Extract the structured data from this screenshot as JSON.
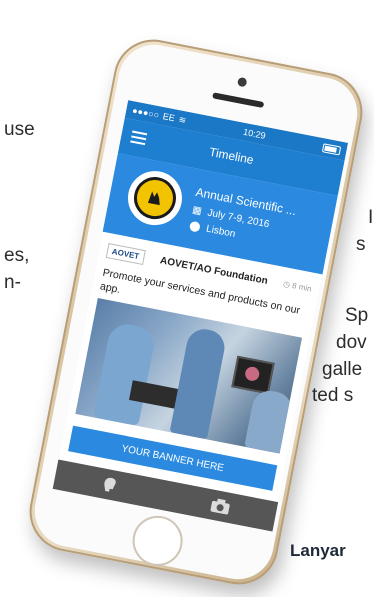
{
  "background_text": {
    "left_1": "use",
    "left_2": "es,",
    "left_3": "n-",
    "right_1": "I",
    "right_2": "s",
    "right_3": "Sp",
    "right_4": "dov",
    "right_5": "galle",
    "right_6": "ted s",
    "bottom": "Lanyar"
  },
  "status_bar": {
    "carrier": "EE",
    "time": "10:29"
  },
  "nav": {
    "title": "Timeline",
    "menu_icon": "hamburger-icon"
  },
  "event": {
    "title": "Annual Scientific ...",
    "date": "July 7-9, 2016",
    "location": "Lisbon",
    "logo_icon": "society-seal-logo"
  },
  "post": {
    "org_logo_text": "AOVET",
    "org_name": "AOVET/AO Foundation",
    "time_ago": "8 min",
    "text": "Promote your services and products on our app."
  },
  "banner": {
    "label": "YOUR BANNER HERE"
  },
  "tabs": [
    {
      "icon": "speaker-head-icon"
    },
    {
      "icon": "camera-icon"
    }
  ],
  "colors": {
    "primary": "#1e7fd1",
    "banner_bg": "#2b8ae0",
    "tabbar": "#565656",
    "phone_gold": "#d8c3a0"
  }
}
